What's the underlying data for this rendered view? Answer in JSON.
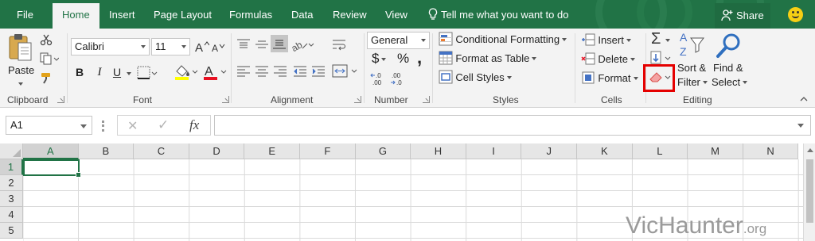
{
  "tabs": [
    {
      "label": "File"
    },
    {
      "label": "Home",
      "active": true
    },
    {
      "label": "Insert"
    },
    {
      "label": "Page Layout"
    },
    {
      "label": "Formulas"
    },
    {
      "label": "Data"
    },
    {
      "label": "Review"
    },
    {
      "label": "View"
    }
  ],
  "tell_me": "Tell me what you want to do",
  "share": "Share",
  "ribbon": {
    "clipboard": {
      "paste": "Paste",
      "group": "Clipboard"
    },
    "font": {
      "name": "Calibri",
      "size": "11",
      "bold": "B",
      "italic": "I",
      "underline": "U",
      "group": "Font",
      "highlight_color": "#ffff00",
      "font_color": "#e81123"
    },
    "alignment": {
      "group": "Alignment"
    },
    "number": {
      "format": "General",
      "currency": "$",
      "percent": "%",
      "comma": ",",
      "group": "Number"
    },
    "styles": {
      "conditional": "Conditional Formatting",
      "table": "Format as Table",
      "cell_styles": "Cell Styles",
      "group": "Styles"
    },
    "cells": {
      "insert": "Insert",
      "delete": "Delete",
      "format": "Format",
      "group": "Cells"
    },
    "editing": {
      "sum": "Σ",
      "sort_a": "A",
      "sort_z": "Z",
      "sort_1": "Sort &",
      "sort_2": "Filter",
      "find_1": "Find &",
      "find_2": "Select",
      "group": "Editing",
      "highlight_color": "#e50000"
    }
  },
  "formula_bar": {
    "name_box": "A1",
    "cancel": "✕",
    "enter": "✓",
    "fx": "fx",
    "value": ""
  },
  "grid": {
    "columns": [
      "A",
      "B",
      "C",
      "D",
      "E",
      "F",
      "G",
      "H",
      "I",
      "J",
      "K",
      "L",
      "M",
      "N"
    ],
    "rows": [
      "1",
      "2",
      "3",
      "4",
      "5"
    ],
    "active_cell": "A1"
  },
  "watermark": {
    "main": "VicHaunter",
    "tld": ".org"
  }
}
